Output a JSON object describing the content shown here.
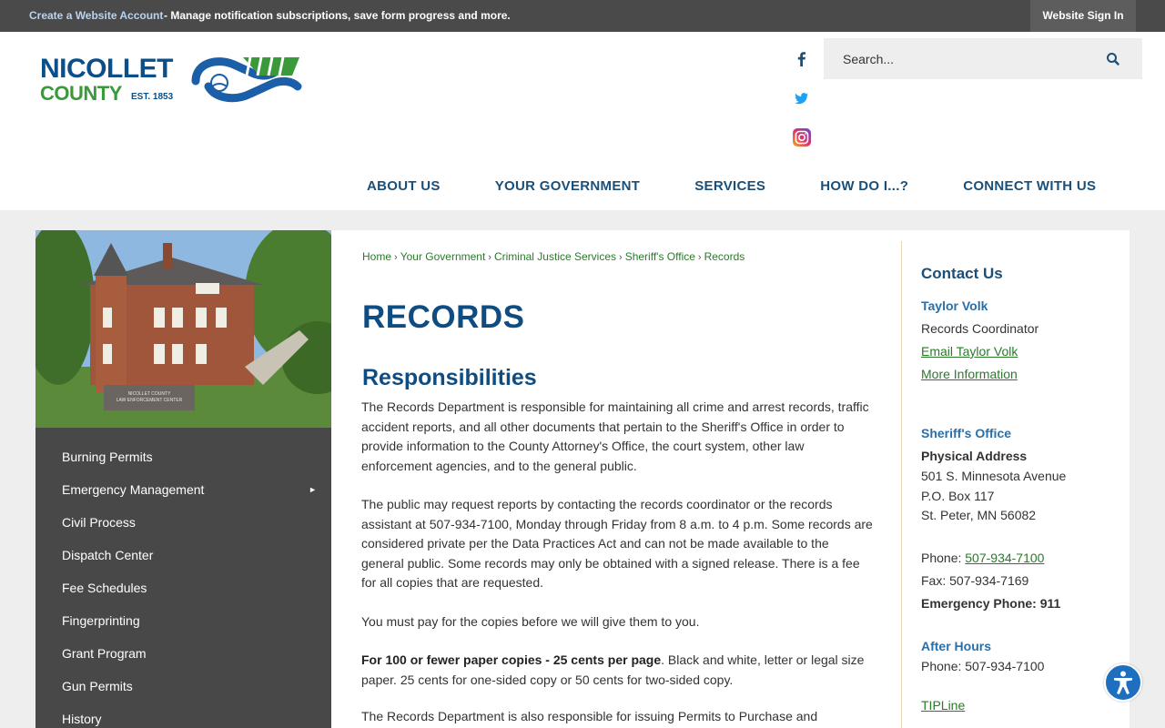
{
  "topbar": {
    "create_link": "Create a Website Account",
    "create_desc": "- Manage notification subscriptions, save form progress and more.",
    "signin": "Website Sign In"
  },
  "logo": {
    "line1": "NICOLLET",
    "line2": "COUNTY",
    "est": "EST. 1853"
  },
  "social": [
    "facebook-icon",
    "twitter-icon",
    "instagram-icon"
  ],
  "search": {
    "placeholder": "Search..."
  },
  "nav": [
    "ABOUT US",
    "YOUR GOVERNMENT",
    "SERVICES",
    "HOW DO I...?",
    "CONNECT WITH US"
  ],
  "photo": {
    "sign_line1": "NICOLLET COUNTY",
    "sign_line2": "LAW ENFORCEMENT CENTER"
  },
  "sidenav": [
    {
      "label": "Burning Permits",
      "has_submenu": false
    },
    {
      "label": "Emergency Management",
      "has_submenu": true
    },
    {
      "label": "Civil Process",
      "has_submenu": false
    },
    {
      "label": "Dispatch Center",
      "has_submenu": false
    },
    {
      "label": "Fee Schedules",
      "has_submenu": false
    },
    {
      "label": "Fingerprinting",
      "has_submenu": false
    },
    {
      "label": "Grant Program",
      "has_submenu": false
    },
    {
      "label": "Gun Permits",
      "has_submenu": false
    },
    {
      "label": "History",
      "has_submenu": false
    }
  ],
  "breadcrumb": [
    "Home",
    "Your Government",
    "Criminal Justice Services",
    "Sheriff's Office",
    "Records"
  ],
  "main": {
    "title": "RECORDS",
    "section_title": "Responsibilities",
    "p1": "The Records Department is responsible for maintaining all crime and arrest records, traffic accident reports, and all other documents that pertain to the Sheriff's Office in order to provide information to the County Attorney's Office, the court system, other law enforcement agencies, and to the general public.",
    "p2": "The public may request reports by contacting the records coordinator or the records assistant at 507-934-7100, Monday through Friday from 8 a.m. to 4 p.m. Some records are considered private per the Data Practices Act and can not be made available to the general public. Some records may only be obtained with a signed release. There is a fee for all copies that are requested.",
    "p3": "You must pay for the copies before we will give them to you.",
    "p4_bold": "For 100 or fewer paper copies - 25 cents per page",
    "p4_rest": ".  Black and white, letter or legal size paper.  25 cents for one-sided copy or 50 cents for two-sided copy.",
    "p5": "The Records Department is also responsible for issuing Permits to Purchase and"
  },
  "contact": {
    "title": "Contact Us",
    "name": "Taylor Volk",
    "role": "Records Coordinator",
    "email_link": "Email Taylor Volk",
    "more_link": "More Information",
    "office": "Sheriff's Office",
    "address_label": "Physical Address",
    "address1": "501 S. Minnesota Avenue",
    "address2": "P.O. Box 117",
    "address3": "St. Peter, MN 56082",
    "phone_label": "Phone: ",
    "phone": "507-934-7100",
    "fax": "Fax: 507-934-7169",
    "emergency": "Emergency Phone: 911",
    "after_hours": "After Hours",
    "after_phone": "Phone: 507-934-7100",
    "tipline": "TIPLine"
  },
  "colors": {
    "topbar": "#4a4a4a",
    "nav_text": "#1a4f7a",
    "title_blue": "#0f4c81",
    "link_green": "#2a7a2a",
    "sidebar_bg": "#484848"
  }
}
